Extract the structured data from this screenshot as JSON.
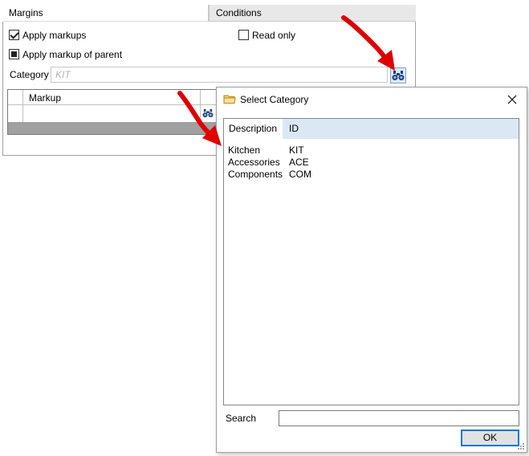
{
  "tabs": [
    {
      "label": "Margins",
      "active": true
    },
    {
      "label": "Conditions",
      "active": false
    }
  ],
  "checkboxes": {
    "apply_markups": {
      "label": "Apply markups",
      "checked": true
    },
    "read_only": {
      "label": "Read only",
      "checked": false
    },
    "apply_markup_of_parent": {
      "label": "Apply markup of parent",
      "state": "indeterminate"
    }
  },
  "category": {
    "label": "Category",
    "placeholder": "KIT"
  },
  "grid": {
    "columns": [
      "Markup"
    ]
  },
  "dialog": {
    "title": "Select Category",
    "columns": [
      "Description",
      "ID"
    ],
    "rows": [
      {
        "description": "Kitchen",
        "id": "KIT"
      },
      {
        "description": "Accessories",
        "id": "ACE"
      },
      {
        "description": "Components",
        "id": "COM"
      }
    ],
    "search_label": "Search",
    "search_value": "",
    "ok_label": "OK",
    "close_icon": "close-icon"
  },
  "colors": {
    "arrow": "#e00000",
    "header_selected": "#dae8f6",
    "ok_border": "#0078d7"
  }
}
